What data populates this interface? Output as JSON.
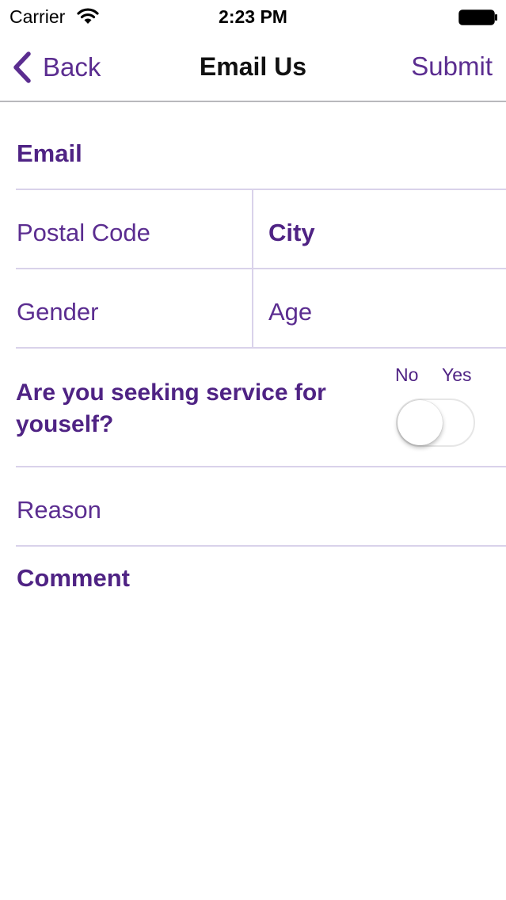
{
  "status_bar": {
    "carrier": "Carrier",
    "time": "2:23 PM",
    "wifi_icon": "wifi-icon",
    "battery_icon": "battery-icon"
  },
  "nav": {
    "back_label": "Back",
    "title": "Email Us",
    "submit_label": "Submit"
  },
  "form": {
    "email_label": "Email",
    "postal_code_label": "Postal Code",
    "city_label": "City",
    "gender_label": "Gender",
    "age_label": "Age",
    "question": "Are you seeking service for youself?",
    "toggle_no": "No",
    "toggle_yes": "Yes",
    "toggle_on": false,
    "reason_label": "Reason",
    "comment_label": "Comment"
  },
  "colors": {
    "accent": "#5b2d90",
    "accent_dark": "#4f2384",
    "divider": "#d9d2ea",
    "nav_border": "#b8b8bc"
  }
}
